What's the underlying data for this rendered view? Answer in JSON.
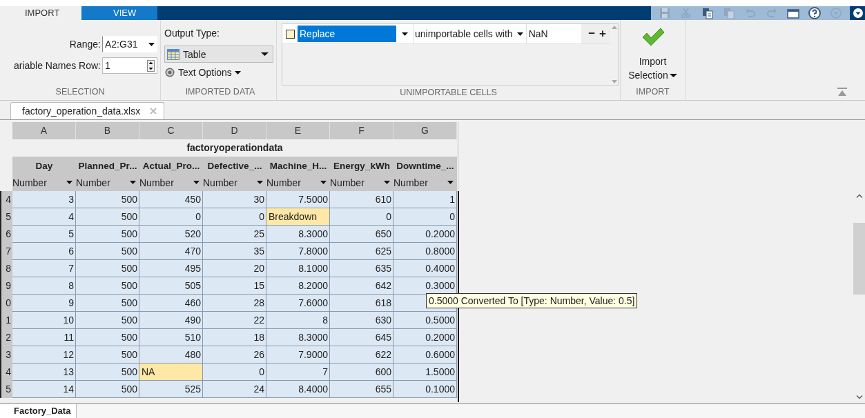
{
  "tabs": [
    {
      "label": "IMPORT",
      "selected": true
    },
    {
      "label": "VIEW",
      "selected": false
    }
  ],
  "ribbon": {
    "selection": {
      "title": "SELECTION",
      "range_label": "Range:",
      "range_value": "A2:G31",
      "names_row_label": "ariable Names Row:",
      "names_row_value": "1"
    },
    "imported_data": {
      "title": "IMPORTED DATA",
      "output_type_label": "Output Type:",
      "output_type": "Table",
      "text_options": "Text Options"
    },
    "unimportable_cells": {
      "title": "UNIMPORTABLE CELLS",
      "rules": [
        {
          "checked": false,
          "action": "Replace",
          "action_selected": true,
          "condition": "unimportable cells with",
          "value": "NaN",
          "remove": "−",
          "add": "+"
        }
      ]
    },
    "import": {
      "title": "IMPORT",
      "button_line1": "Import",
      "button_line2": "Selection"
    }
  },
  "file_tabs": [
    {
      "label": "factory_operation_data.xlsx"
    }
  ],
  "sheet": {
    "column_letters": [
      "A",
      "B",
      "C",
      "D",
      "E",
      "F",
      "G"
    ],
    "title": "factoryoperationdata",
    "variable_names": [
      "Day",
      "Planned_Pr...",
      "Actual_Pro...",
      "Defective_...",
      "Machine_H...",
      "Energy_kWh",
      "Downtime_..."
    ],
    "variable_types": [
      "Number",
      "Number",
      "Number",
      "Number",
      "Number",
      "Number",
      "Number"
    ],
    "rows": [
      {
        "row_header": "4",
        "cells": [
          {
            "text": "3",
            "unimportable": false
          },
          {
            "text": "500",
            "unimportable": false
          },
          {
            "text": "450",
            "unimportable": false
          },
          {
            "text": "30",
            "unimportable": false
          },
          {
            "text": "7.5000",
            "unimportable": false
          },
          {
            "text": "610",
            "unimportable": false
          },
          {
            "text": "1",
            "unimportable": false
          }
        ]
      },
      {
        "row_header": "5",
        "cells": [
          {
            "text": "4",
            "unimportable": false
          },
          {
            "text": "500",
            "unimportable": false
          },
          {
            "text": "0",
            "unimportable": false
          },
          {
            "text": "0",
            "unimportable": false
          },
          {
            "text": "Breakdown",
            "unimportable": true
          },
          {
            "text": "0",
            "unimportable": false
          },
          {
            "text": "0",
            "unimportable": false
          }
        ]
      },
      {
        "row_header": "6",
        "cells": [
          {
            "text": "5",
            "unimportable": false
          },
          {
            "text": "500",
            "unimportable": false
          },
          {
            "text": "520",
            "unimportable": false
          },
          {
            "text": "25",
            "unimportable": false
          },
          {
            "text": "8.3000",
            "unimportable": false
          },
          {
            "text": "650",
            "unimportable": false
          },
          {
            "text": "0.2000",
            "unimportable": false
          }
        ]
      },
      {
        "row_header": "7",
        "cells": [
          {
            "text": "6",
            "unimportable": false
          },
          {
            "text": "500",
            "unimportable": false
          },
          {
            "text": "470",
            "unimportable": false
          },
          {
            "text": "35",
            "unimportable": false
          },
          {
            "text": "7.8000",
            "unimportable": false
          },
          {
            "text": "625",
            "unimportable": false
          },
          {
            "text": "0.8000",
            "unimportable": false
          }
        ]
      },
      {
        "row_header": "8",
        "cells": [
          {
            "text": "7",
            "unimportable": false
          },
          {
            "text": "500",
            "unimportable": false
          },
          {
            "text": "495",
            "unimportable": false
          },
          {
            "text": "20",
            "unimportable": false
          },
          {
            "text": "8.1000",
            "unimportable": false
          },
          {
            "text": "635",
            "unimportable": false
          },
          {
            "text": "0.4000",
            "unimportable": false
          }
        ]
      },
      {
        "row_header": "9",
        "cells": [
          {
            "text": "8",
            "unimportable": false
          },
          {
            "text": "500",
            "unimportable": false
          },
          {
            "text": "505",
            "unimportable": false
          },
          {
            "text": "15",
            "unimportable": false
          },
          {
            "text": "8.2000",
            "unimportable": false
          },
          {
            "text": "642",
            "unimportable": false
          },
          {
            "text": "0.3000",
            "unimportable": false
          }
        ]
      },
      {
        "row_header": "0",
        "cells": [
          {
            "text": "9",
            "unimportable": false
          },
          {
            "text": "500",
            "unimportable": false
          },
          {
            "text": "460",
            "unimportable": false
          },
          {
            "text": "28",
            "unimportable": false
          },
          {
            "text": "7.6000",
            "unimportable": false
          },
          {
            "text": "618",
            "unimportable": false
          },
          {
            "unimportable": false
          }
        ]
      },
      {
        "row_header": "1",
        "cells": [
          {
            "text": "10",
            "unimportable": false
          },
          {
            "text": "500",
            "unimportable": false
          },
          {
            "text": "490",
            "unimportable": false
          },
          {
            "text": "22",
            "unimportable": false
          },
          {
            "text": "8",
            "unimportable": false
          },
          {
            "text": "630",
            "unimportable": false
          },
          {
            "text": "0.5000",
            "unimportable": false
          }
        ]
      },
      {
        "row_header": "2",
        "cells": [
          {
            "text": "11",
            "unimportable": false
          },
          {
            "text": "500",
            "unimportable": false
          },
          {
            "text": "510",
            "unimportable": false
          },
          {
            "text": "18",
            "unimportable": false
          },
          {
            "text": "8.3000",
            "unimportable": false
          },
          {
            "text": "645",
            "unimportable": false
          },
          {
            "text": "0.2000",
            "unimportable": false
          }
        ]
      },
      {
        "row_header": "3",
        "cells": [
          {
            "text": "12",
            "unimportable": false
          },
          {
            "text": "500",
            "unimportable": false
          },
          {
            "text": "480",
            "unimportable": false
          },
          {
            "text": "26",
            "unimportable": false
          },
          {
            "text": "7.9000",
            "unimportable": false
          },
          {
            "text": "622",
            "unimportable": false
          },
          {
            "text": "0.6000",
            "unimportable": false
          }
        ]
      },
      {
        "row_header": "4",
        "cells": [
          {
            "text": "13",
            "unimportable": false
          },
          {
            "text": "500",
            "unimportable": false
          },
          {
            "text": "NA",
            "unimportable": true
          },
          {
            "text": "0",
            "unimportable": false
          },
          {
            "text": "7",
            "unimportable": false
          },
          {
            "text": "600",
            "unimportable": false
          },
          {
            "text": "1.5000",
            "unimportable": false
          }
        ]
      },
      {
        "row_header": "5",
        "cells": [
          {
            "text": "14",
            "unimportable": false
          },
          {
            "text": "500",
            "unimportable": false
          },
          {
            "text": "525",
            "unimportable": false
          },
          {
            "text": "24",
            "unimportable": false
          },
          {
            "text": "8.4000",
            "unimportable": false
          },
          {
            "text": "655",
            "unimportable": false
          },
          {
            "text": "0.1000",
            "unimportable": false
          }
        ]
      }
    ]
  },
  "tooltip": "0.5000 Converted To [Type: Number, Value: 0.5]",
  "sheet_tabs": [
    {
      "label": "Factory_Data"
    }
  ]
}
